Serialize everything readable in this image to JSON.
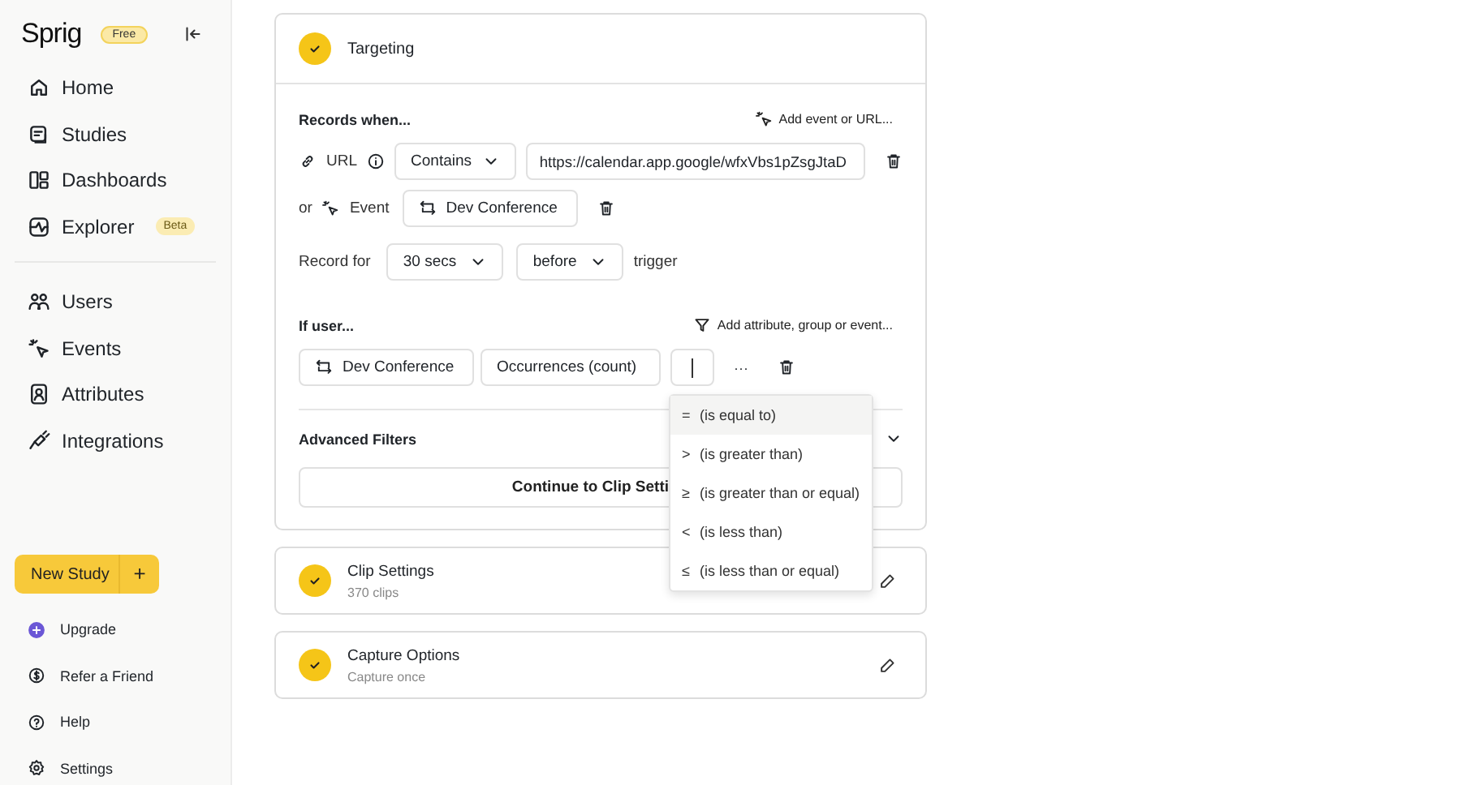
{
  "sidebar": {
    "logo": "Sprig",
    "plan_badge": "Free",
    "nav_items": [
      {
        "label": "Home"
      },
      {
        "label": "Studies"
      },
      {
        "label": "Dashboards"
      },
      {
        "label": "Explorer",
        "badge": "Beta"
      }
    ],
    "secondary_items": [
      {
        "label": "Users"
      },
      {
        "label": "Events"
      },
      {
        "label": "Attributes"
      },
      {
        "label": "Integrations"
      }
    ],
    "new_study_button": {
      "label": "New Study",
      "plus": "+"
    },
    "footer_items": [
      {
        "label": "Upgrade"
      },
      {
        "label": "Refer a Friend"
      },
      {
        "label": "Help"
      },
      {
        "label": "Settings"
      }
    ]
  },
  "targeting": {
    "title": "Targeting",
    "completed": true,
    "records_when": {
      "heading": "Records when...",
      "add_link": "Add event or URL...",
      "url_row": {
        "label": "URL",
        "operator": "Contains",
        "value": "https://calendar.app.google/wfxVbs1pZsgJtaD"
      },
      "event_row": {
        "connector": "or",
        "label": "Event",
        "value": "Dev Conference"
      },
      "record_for": {
        "label": "Record for",
        "duration": "30 secs",
        "timing": "before",
        "suffix": "trigger"
      }
    },
    "if_user": {
      "heading": "If user...",
      "add_link": "Add attribute, group or event...",
      "event": "Dev Conference",
      "metric": "Occurrences (count)",
      "more": "···"
    },
    "advanced_filters": "Advanced Filters",
    "continue_button": "Continue to Clip Setti",
    "operator_menu": [
      {
        "symbol": "=",
        "label": "(is equal to)",
        "selected": true
      },
      {
        "symbol": ">",
        "label": "(is greater than)",
        "selected": false
      },
      {
        "symbol": "≥",
        "label": "(is greater than or equal)",
        "selected": false
      },
      {
        "symbol": "<",
        "label": "(is less than)",
        "selected": false
      },
      {
        "symbol": "≤",
        "label": "(is less than or equal)",
        "selected": false
      }
    ]
  },
  "steps": [
    {
      "title": "Clip Settings",
      "subtitle": "370 clips",
      "completed": true
    },
    {
      "title": "Capture Options",
      "subtitle": "Capture once",
      "completed": true
    }
  ]
}
